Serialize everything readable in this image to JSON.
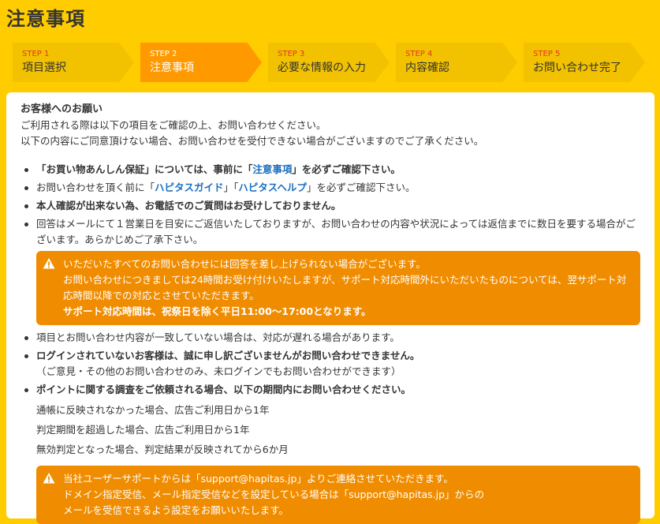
{
  "page": {
    "title": "注意事項"
  },
  "steps": [
    {
      "num": "STEP 1",
      "label": "項目選択"
    },
    {
      "num": "STEP 2",
      "label": "注意事項"
    },
    {
      "num": "STEP 3",
      "label": "必要な情報の入力"
    },
    {
      "num": "STEP 4",
      "label": "内容確認"
    },
    {
      "num": "STEP 5",
      "label": "お問い合わせ完了"
    }
  ],
  "intro": {
    "title": "お客様へのお願い",
    "line1": "ご利用される際は以下の項目をご確認の上、お問い合わせください。",
    "line2": "以下の内容にご同意頂けない場合、お問い合わせを受付できない場合がございますのでご了承ください。"
  },
  "notes": {
    "n1": {
      "pre": "「お買い物あんしん保証」については、事前に「",
      "link": "注意事項",
      "post": "」を必ずご確認下さい。"
    },
    "n2": {
      "pre": "お問い合わせを頂く前に「",
      "link1": "ハピタスガイド",
      "mid": "」「",
      "link2": "ハピタスヘルプ",
      "post": "」を必ずご確認下さい。"
    },
    "n3": "本人確認が出来ない為、お電話でのご質問はお受けしておりません。",
    "n4": "回答はメールにて１営業日を目安にご返信いたしておりますが、お問い合わせの内容や状況によっては返信までに数日を要する場合がございます。あらかじめご了承下さい。",
    "warn1": {
      "line1": "いただいたすべてのお問い合わせには回答を差し上げられない場合がございます。",
      "line2": "お問い合わせにつきましては24時間お受け付けいたしますが、サポート対応時間外にいただいたものについては、翌サポート対応時間以降での対応とさせていただきます。",
      "line3": "サポート対応時間は、祝祭日を除く平日11:00～17:00となります。"
    },
    "n5": "項目とお問い合わせ内容が一致していない場合は、対応が遅れる場合があります。",
    "n6": {
      "main": "ログインされていないお客様は、誠に申し訳ございませんがお問い合わせできません。",
      "sub": "（ご意見・その他のお問い合わせのみ、未ログインでもお問い合わせができます）"
    },
    "n7": "ポイントに関する調査をご依頼される場合、以下の期間内にお問い合わせください。",
    "periods": [
      "通帳に反映されなかった場合、広告ご利用日から1年",
      "判定期間を超過した場合、広告ご利用日から1年",
      "無効判定となった場合、判定結果が反映されてから6か月"
    ],
    "warn2": {
      "line1": "当社ユーザーサポートからは「support@hapitas.jp」よりご連絡させていただきます。",
      "line2": "ドメイン指定受信、メール指定受信などを設定している場合は「support@hapitas.jp」からの",
      "line3": "メールを受信できるよう設定をお願いいたします。"
    }
  },
  "colors": {
    "background": "#ffcc00",
    "step": "#f2c200",
    "step_active": "#ff9900",
    "warn": "#f08c00",
    "link": "#1a6fc0",
    "step_num": "#e8332b"
  }
}
